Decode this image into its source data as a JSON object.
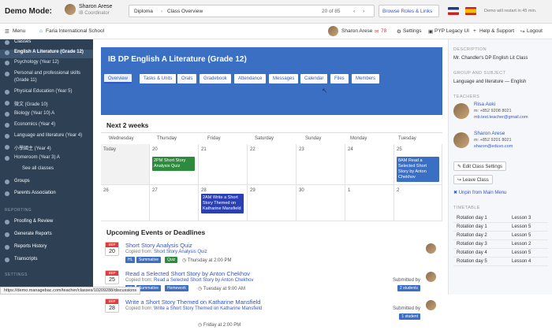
{
  "demo": {
    "label": "Demo Mode:",
    "user": "Sharon Arese",
    "role": "IB Coordinator",
    "crumb1": "Diploma",
    "crumb2": "Class Overview",
    "count": "20 of 85",
    "browse": "Browse Roles & Links",
    "restart": "Demo will restart in 45 min."
  },
  "nav": {
    "menu": "Menu",
    "school": "Faria International School",
    "user": "Sharon Arese",
    "points": "78",
    "settings": "Settings",
    "legacy": "PYP Legacy UI",
    "help": "Help & Support",
    "logout": "Logout"
  },
  "sidebar": {
    "classes": "Classes",
    "items": [
      "English A Literature (Grade 12)",
      "Psychology (Year 12)",
      "Personal and professional skills",
      "(Grade 11)",
      "Physical Education (Year 5)",
      "微文 (Grade 10)",
      "Biology (Year 10) A",
      "Economics (Year 4)",
      "Language and literature (Year 4)",
      "小學國主 (Year 4)",
      "Homeroom (Year 3) A",
      "See all classes",
      "Groups",
      "Parents Association",
      "REPORTING",
      "Proofing & Review",
      "Generate Reports",
      "Reports History",
      "Transcripts",
      "SETTINGS"
    ]
  },
  "header": {
    "title": "IB DP English A Literature (Grade 12)",
    "tabs": [
      "Overview",
      "Tasks & Units",
      "Orals",
      "Gradebook",
      "Attendance",
      "Messages",
      "Calendar",
      "Files",
      "Members"
    ]
  },
  "calendar": {
    "heading": "Next 2 weeks",
    "days": [
      "Wednesday",
      "Thursday",
      "Friday",
      "Saturday",
      "Sunday",
      "Monday",
      "Tuesday"
    ],
    "row1": [
      "Today",
      "20",
      "21",
      "22",
      "23",
      "24",
      "25"
    ],
    "row2": [
      "26",
      "27",
      "28",
      "29",
      "30",
      "1",
      "2"
    ],
    "ev1": "2PM Short Story Analysis Quiz",
    "ev2": "8AM Read a Selected Short Story by Anton Chekhov",
    "ev3": "2AM Write a Short Story Themed on Katharine Mansfield"
  },
  "upcoming": {
    "heading": "Upcoming Events or Deadlines",
    "items": [
      {
        "mon": "SEP",
        "day": "20",
        "title": "Short Story Analysis Quiz",
        "copied": "Copied from:",
        "src": "Short Story Analysis Quiz",
        "tags": [
          "HL",
          "Summative",
          "Quiz"
        ],
        "due": "Thursday at 2:00 PM"
      },
      {
        "mon": "SEP",
        "day": "25",
        "title": "Read a Selected Short Story by Anton Chekhov",
        "copied": "Copied from:",
        "src": "Read a Selected Short Story by Anton Chekhov",
        "tags": [
          "HL",
          "Summative",
          "Homework"
        ],
        "due": "Tuesday at 9:00 AM",
        "submitted": "Submitted by",
        "students": "2 students"
      },
      {
        "mon": "SEP",
        "day": "28",
        "title": "Write a Short Story Themed on Katharine Mansfield",
        "copied": "Copied from:",
        "src": "Write a Short Story Themed on Katharine Mansfield",
        "tags": [],
        "due": "Friday at 2:00 PM",
        "submitted": "Submitted by",
        "students": "1 student"
      }
    ]
  },
  "right": {
    "desc_lab": "DESCRIPTION",
    "desc": "Mr. Chandler's DP English Lit Class",
    "grp_lab": "GROUP AND SUBJECT",
    "grp": "Language and literature — English",
    "teach_lab": "TEACHERS",
    "t1": {
      "name": "Risa Aoki",
      "phone": "m: +852 9208 8021",
      "email": "mb.test.teacher@gmail.com"
    },
    "t2": {
      "name": "Sharon Arese",
      "phone": "m: +852 9201 8021",
      "email": "sharon@eduvo.com"
    },
    "edit": "Edit Class Settings",
    "leave": "Leave Class",
    "unpin": "Unpin from Main Menu",
    "tt_lab": "TIMETABLE",
    "tt": [
      [
        "Rotation day 1",
        "Lesson 3"
      ],
      [
        "Rotation day 1",
        "Lesson 5"
      ],
      [
        "Rotation day 2",
        "Lesson 5"
      ],
      [
        "Rotation day 3",
        "Lesson 2"
      ],
      [
        "Rotation day 4",
        "Lesson 5"
      ],
      [
        "Rotation day 5",
        "Lesson 4"
      ]
    ]
  },
  "status": "https://demo.managebac.com/teacher/classes/10209288/discussions",
  "colors": {
    "blue": "#3b6fc4",
    "green": "#2e8b3d",
    "navy": "#2e4054",
    "red": "#d93f3f"
  }
}
